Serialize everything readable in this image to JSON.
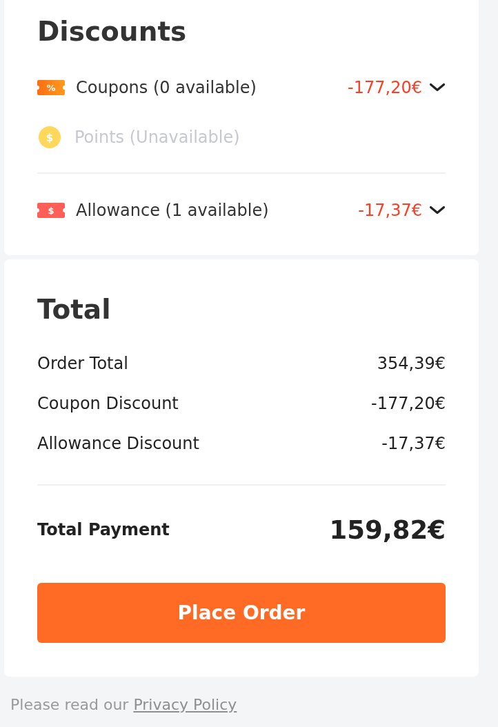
{
  "discounts": {
    "title": "Discounts",
    "groups": [
      [
        {
          "kind": "coupon",
          "symbol": "%",
          "label": "Coupons (0 available)",
          "amount": "-177,20€",
          "disabled": false
        },
        {
          "kind": "points",
          "symbol": "$",
          "label": "Points (Unavailable)",
          "disabled": true
        }
      ],
      [
        {
          "kind": "allowance",
          "symbol": "$",
          "label": "Allowance (1 available)",
          "amount": "-17,37€",
          "disabled": false
        }
      ]
    ]
  },
  "total": {
    "title": "Total",
    "rows": [
      {
        "label": "Order Total",
        "value": "354,39€"
      },
      {
        "label": "Coupon Discount",
        "value": "-177,20€"
      },
      {
        "label": "Allowance Discount",
        "value": "-17,37€"
      }
    ],
    "payment": {
      "label": "Total Payment",
      "amount": "159,82€"
    }
  },
  "place_order_button": "Place Order",
  "footer": {
    "text": "Please read our",
    "link": "Privacy Policy"
  }
}
